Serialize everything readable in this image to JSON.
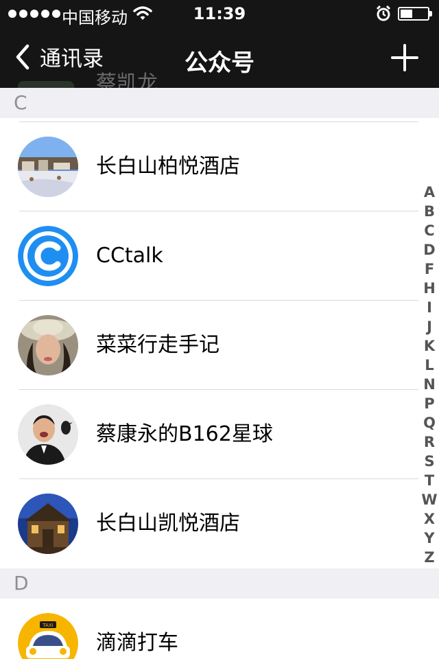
{
  "status_bar": {
    "carrier": "中国移动",
    "time": "11:39",
    "signal_dots": 5,
    "battery_level": 0.45,
    "icons": [
      "signal-dots-icon",
      "wifi-icon",
      "alarm-icon",
      "battery-icon"
    ]
  },
  "nav": {
    "back_label": "通讯录",
    "title": "公众号",
    "ghost_text": "蔡凯龙",
    "icons": [
      "chevron-left-icon",
      "plus-icon"
    ]
  },
  "sections": [
    {
      "letter": "C",
      "items": [
        {
          "name": "长白山柏悦酒店",
          "avatar": "resort-photo-avatar"
        },
        {
          "name": "CCtalk",
          "avatar": "cctalk-logo-avatar"
        },
        {
          "name": "菜菜行走手记",
          "avatar": "woman-hat-avatar"
        },
        {
          "name": "蔡康永的B162星球",
          "avatar": "man-with-bird-avatar"
        },
        {
          "name": "长白山凯悦酒店",
          "avatar": "hotel-night-avatar"
        }
      ]
    },
    {
      "letter": "D",
      "items": [
        {
          "name": "滴滴打车",
          "avatar": "taxi-logo-avatar"
        }
      ]
    }
  ],
  "index_letters": [
    "A",
    "B",
    "C",
    "D",
    "F",
    "H",
    "I",
    "J",
    "K",
    "L",
    "N",
    "P",
    "Q",
    "R",
    "S",
    "T",
    "W",
    "X",
    "Y",
    "Z"
  ],
  "colors": {
    "bar_background": "#151515",
    "section_background": "#efeff4",
    "section_text": "#8e8e93",
    "divider": "#d9d9d9",
    "cctalk_blue": "#1e8ff0",
    "taxi_yellow": "#f7b500"
  }
}
